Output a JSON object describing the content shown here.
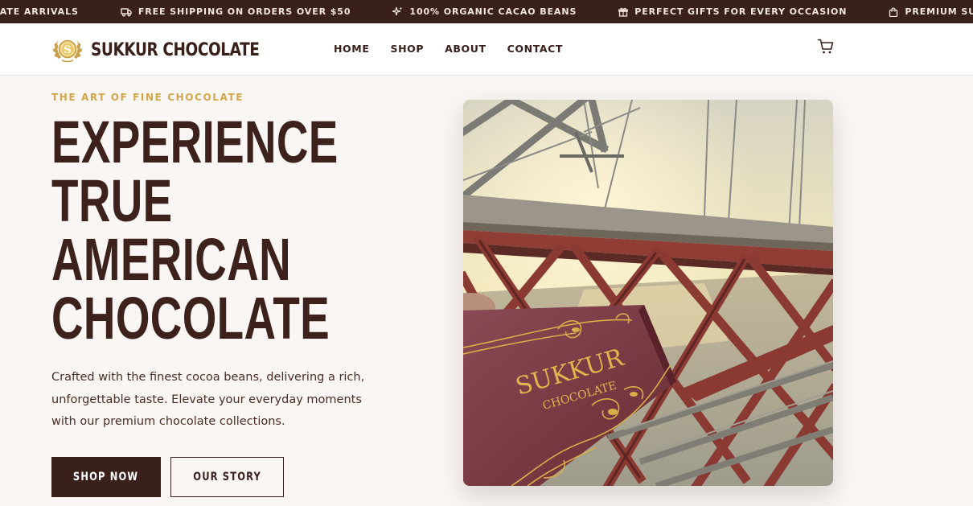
{
  "announcement": {
    "items": [
      {
        "icon": "sparkle-icon",
        "text": "NEW CHOCOLATE ARRIVALS"
      },
      {
        "icon": "truck-icon",
        "text": "FREE SHIPPING ON ORDERS OVER $50"
      },
      {
        "icon": "sparkle-icon",
        "text": "100% ORGANIC CACAO BEANS"
      },
      {
        "icon": "gift-icon",
        "text": "PERFECT GIFTS FOR EVERY OCCASION"
      },
      {
        "icon": "bag-icon",
        "text": "PREMIUM SUKKUR CHOCOLATE"
      }
    ]
  },
  "header": {
    "brand": "SUKKUR CHOCOLATE",
    "logo_letter": "S",
    "nav": [
      "HOME",
      "SHOP",
      "ABOUT",
      "CONTACT"
    ],
    "cart_icon": "cart-icon"
  },
  "hero": {
    "eyebrow": "THE ART OF FINE CHOCOLATE",
    "headline": [
      "EXPERIENCE",
      "TRUE",
      "AMERICAN",
      "CHOCOLATE"
    ],
    "lede": "Crafted with the finest cocoa beans, delivering a rich, unforgettable taste. Elevate your everyday moments with our premium chocolate collections.",
    "primary_cta": "SHOP NOW",
    "secondary_cta": "OUR STORY",
    "photo": {
      "package_line1": "SUKKUR",
      "package_line2": "CHOCOLATE"
    }
  },
  "colors": {
    "brand_dark": "#3a201b",
    "gold": "#d4a64a",
    "background": "#f9f6f3",
    "package": "#7e3a44"
  }
}
